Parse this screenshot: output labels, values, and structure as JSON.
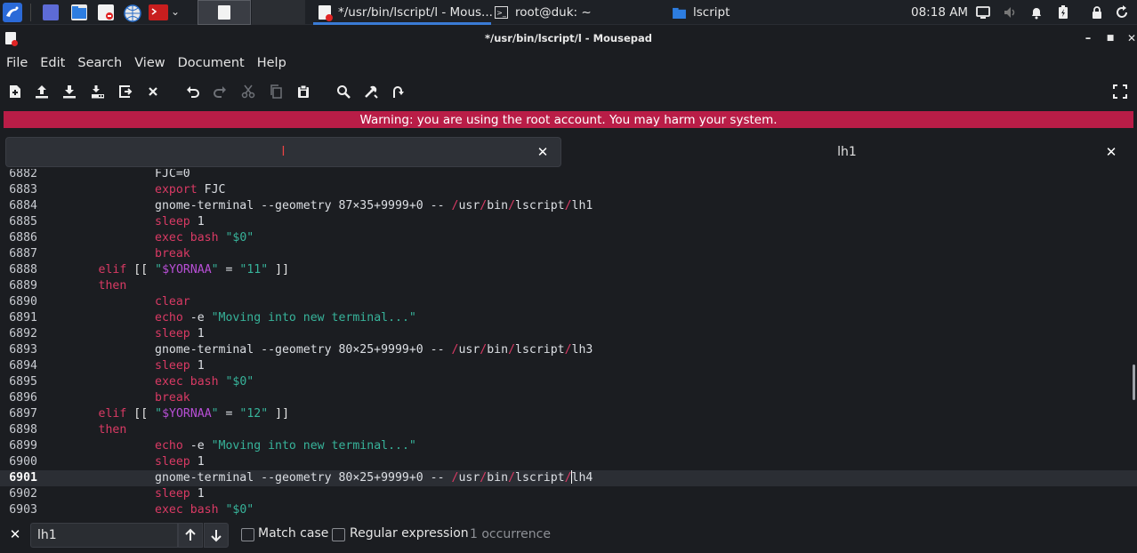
{
  "taskbar": {
    "tasks": [
      {
        "label": "*/usr/bin/lscript/l - Mous..."
      },
      {
        "label": "root@duk: ~"
      },
      {
        "label": "lscript"
      }
    ],
    "clock": "08:18 AM"
  },
  "window": {
    "title": "*/usr/bin/lscript/l - Mousepad",
    "controls": {
      "minimize": "–",
      "maximize": "■",
      "close": "✕"
    }
  },
  "menu": [
    "File",
    "Edit",
    "Search",
    "View",
    "Document",
    "Help"
  ],
  "toolbar": {
    "icons": [
      "new-document-icon",
      "open-icon",
      "save-icon",
      "save-as-icon",
      "reload-icon",
      "close-document-icon",
      "undo-icon",
      "redo-icon",
      "cut-icon",
      "copy-icon",
      "paste-icon",
      "find-icon",
      "find-replace-icon",
      "go-to-line-icon",
      "fullscreen-icon"
    ]
  },
  "warning": "Warning: you are using the root account. You may harm your system.",
  "tabs": [
    {
      "label": "l",
      "active": true
    },
    {
      "label": "lh1",
      "active": false
    }
  ],
  "editor": {
    "lines": [
      {
        "n": "6882",
        "code": "\t\tFJC=0"
      },
      {
        "n": "6883",
        "code": "\t\texport FJC"
      },
      {
        "n": "6884",
        "code": "\t\tgnome-terminal --geometry 87×35+9999+0 -- /usr/bin/lscript/lh1"
      },
      {
        "n": "6885",
        "code": "\t\tsleep 1"
      },
      {
        "n": "6886",
        "code": "\t\texec bash \"$0\""
      },
      {
        "n": "6887",
        "code": "\t\tbreak"
      },
      {
        "n": "6888",
        "code": "\telif [[ \"$YORNAA\" = \"11\" ]]"
      },
      {
        "n": "6889",
        "code": "\tthen"
      },
      {
        "n": "6890",
        "code": "\t\tclear"
      },
      {
        "n": "6891",
        "code": "\t\techo -e \"Moving into new terminal...\""
      },
      {
        "n": "6892",
        "code": "\t\tsleep 1"
      },
      {
        "n": "6893",
        "code": "\t\tgnome-terminal --geometry 80×25+9999+0 -- /usr/bin/lscript/lh3"
      },
      {
        "n": "6894",
        "code": "\t\tsleep 1"
      },
      {
        "n": "6895",
        "code": "\t\texec bash \"$0\""
      },
      {
        "n": "6896",
        "code": "\t\tbreak"
      },
      {
        "n": "6897",
        "code": "\telif [[ \"$YORNAA\" = \"12\" ]]"
      },
      {
        "n": "6898",
        "code": "\tthen"
      },
      {
        "n": "6899",
        "code": "\t\techo -e \"Moving into new terminal...\""
      },
      {
        "n": "6900",
        "code": "\t\tsleep 1"
      },
      {
        "n": "6901",
        "code": "\t\tgnome-terminal --geometry 80×25+9999+0 -- /usr/bin/lscript/lh4",
        "current": true
      },
      {
        "n": "6902",
        "code": "\t\tsleep 1"
      },
      {
        "n": "6903",
        "code": "\t\texec bash \"$0\""
      }
    ]
  },
  "search": {
    "query": "lh1",
    "match_case_label": "Match case",
    "regex_label": "Regular expression",
    "occurrences": "1 occurrence"
  }
}
